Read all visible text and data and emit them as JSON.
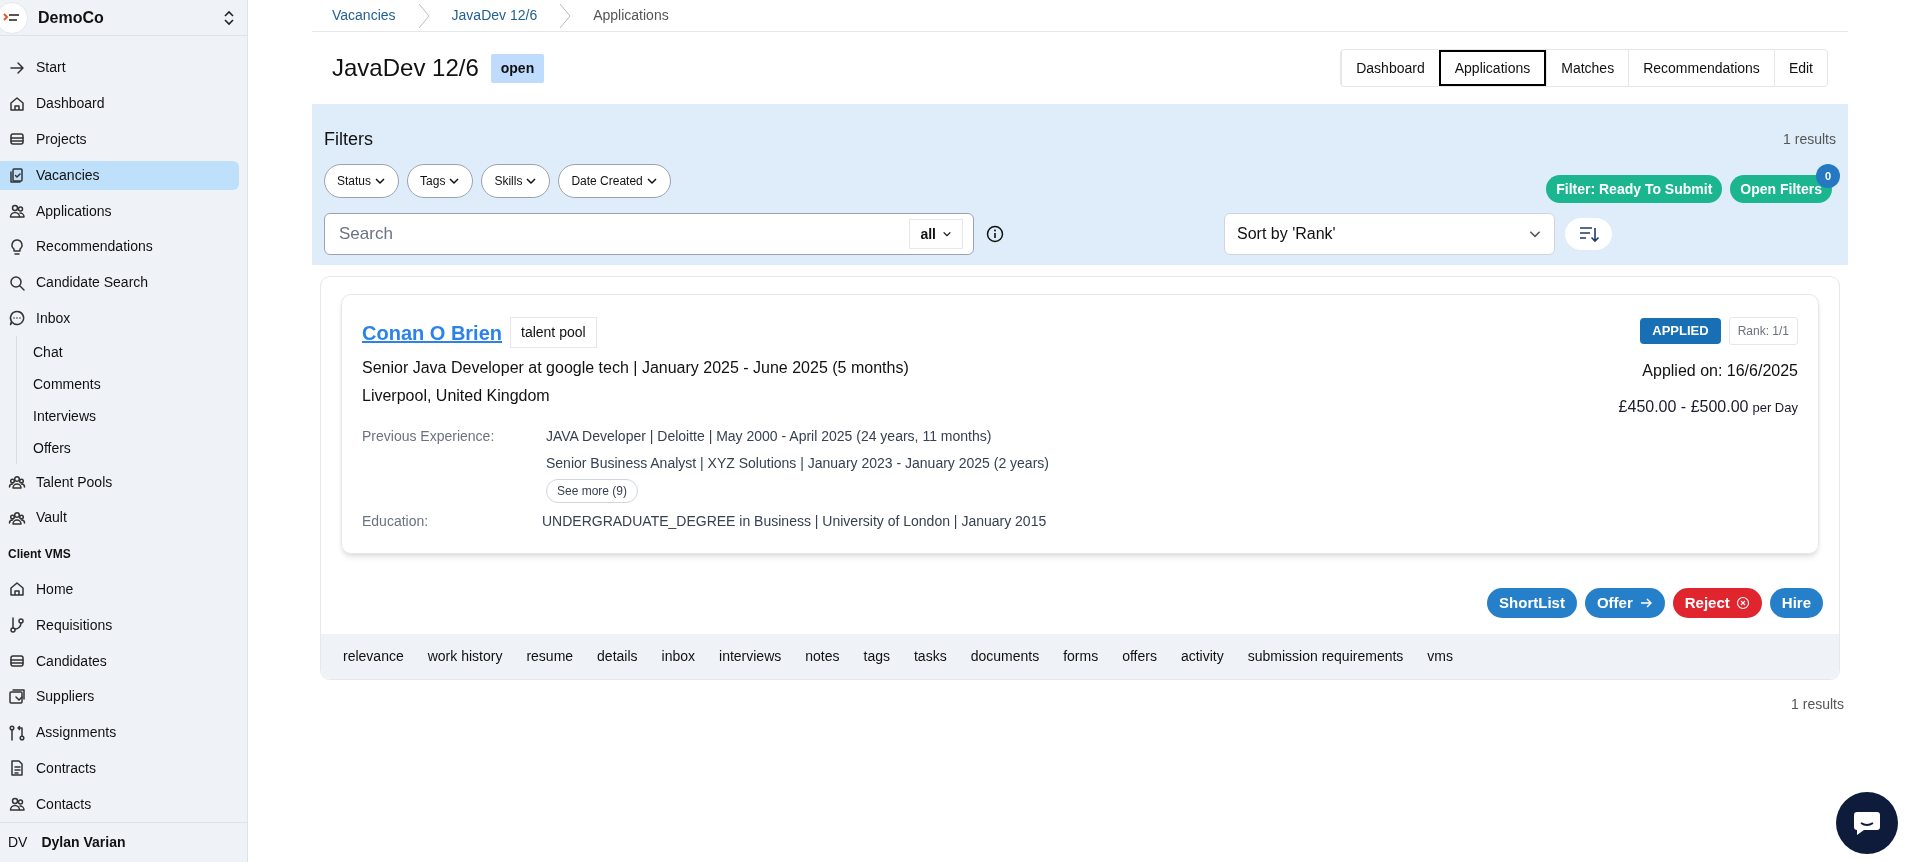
{
  "org": {
    "name": "DemoCo"
  },
  "sidebar": {
    "items": [
      {
        "label": "Start",
        "selected": false
      },
      {
        "label": "Dashboard",
        "selected": false
      },
      {
        "label": "Projects",
        "selected": false
      },
      {
        "label": "Vacancies",
        "selected": true
      },
      {
        "label": "Applications",
        "selected": false
      },
      {
        "label": "Recommendations",
        "selected": false
      },
      {
        "label": "Candidate Search",
        "selected": false
      },
      {
        "label": "Inbox",
        "selected": false,
        "children": [
          {
            "label": "Chat",
            "selected": false
          },
          {
            "label": "Comments",
            "selected": false
          },
          {
            "label": "Interviews",
            "selected": false
          },
          {
            "label": "Offers",
            "selected": false
          }
        ]
      },
      {
        "label": "Talent Pools",
        "selected": false
      },
      {
        "label": "Vault",
        "selected": false
      }
    ],
    "section": "Client VMS",
    "vms_items": [
      {
        "label": "Home",
        "selected": false
      },
      {
        "label": "Requisitions",
        "selected": false
      },
      {
        "label": "Candidates",
        "selected": false
      },
      {
        "label": "Suppliers",
        "selected": false
      },
      {
        "label": "Assignments",
        "selected": false
      },
      {
        "label": "Contracts",
        "selected": false
      },
      {
        "label": "Contacts",
        "selected": false
      }
    ]
  },
  "user": {
    "initials": "DV",
    "name": "Dylan Varian"
  },
  "breadcrumb": [
    "Vacancies",
    "JavaDev 12/6",
    "Applications"
  ],
  "vacancy": {
    "title": "JavaDev 12/6",
    "status": "open"
  },
  "tabs": [
    {
      "label": "Dashboard",
      "selected": false
    },
    {
      "label": "Applications",
      "selected": true
    },
    {
      "label": "Matches",
      "selected": false
    },
    {
      "label": "Recommendations",
      "selected": false
    },
    {
      "label": "Edit",
      "selected": false
    }
  ],
  "filters": {
    "title": "Filters",
    "results": "1 results",
    "chips": [
      "Status",
      "Tags",
      "Skills",
      "Date Created"
    ],
    "quick_filter": "Filter: Ready To Submit",
    "open_filters": "Open Filters",
    "open_filters_count": "0",
    "search": {
      "placeholder": "Search",
      "scope": "all"
    },
    "sort": "Sort by 'Rank'"
  },
  "application": {
    "name": "Conan O Brien",
    "tag": "talent pool",
    "headline": "Senior Java Developer at google tech | January 2025 - June 2025 (5 months)",
    "location": "Liverpool, United Kingdom",
    "status": "APPLIED",
    "rank": "Rank: 1/1",
    "applied_on": "Applied on: 16/6/2025",
    "rate": "£450.00 - £500.00",
    "rate_unit": "per Day",
    "previous_experience": {
      "label": "Previous Experience:",
      "entries": [
        "JAVA Developer | Deloitte | May 2000 - April 2025 (24 years, 11 months)",
        "Senior Business Analyst | XYZ Solutions | January 2023 - January 2025 (2 years)"
      ],
      "see_more": "See more (9)"
    },
    "education": {
      "label": "Education:",
      "value": "UNDERGRADUATE_DEGREE in Business | University of London | January 2015"
    },
    "actions": [
      {
        "label": "ShortList",
        "kind": "default"
      },
      {
        "label": "Offer",
        "kind": "forward"
      },
      {
        "label": "Reject",
        "kind": "danger"
      },
      {
        "label": "Hire",
        "kind": "default"
      }
    ],
    "detail_tabs": [
      "relevance",
      "work history",
      "resume",
      "details",
      "inbox",
      "interviews",
      "notes",
      "tags",
      "tasks",
      "documents",
      "forms",
      "offers",
      "activity",
      "submission requirements",
      "vms"
    ]
  },
  "results_footer": "1 results"
}
